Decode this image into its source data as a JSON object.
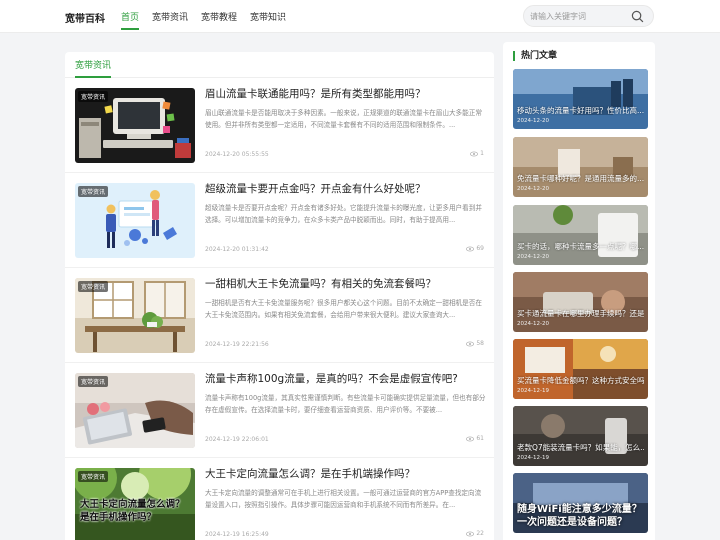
{
  "header": {
    "brand": "宽带百科",
    "nav": [
      "首页",
      "宽带资讯",
      "宽带教程",
      "宽带知识"
    ],
    "search_placeholder": "请输入关键字词"
  },
  "main": {
    "tab": "宽带资讯",
    "articles": [
      {
        "badge": "宽带资讯",
        "title": "眉山流量卡联通能用吗？是所有类型都能用吗？",
        "desc": "眉山联通流量卡是否能用取决于多种因素。一般来说，正规渠道的联通流量卡在眉山大多能正常使用。但并非所有类型都一定适用，不同流量卡套餐有不同的适用范围和限制条件。...",
        "date": "2024-12-20 05:55:55",
        "views": "1"
      },
      {
        "badge": "宽带资讯",
        "title": "超级流量卡要开点金吗？开点金有什么好处呢？",
        "desc": "超级流量卡是否要开点金呢？开点金有诸多好处。它能提升流量卡的曝光度，让更多用户看到并选择。可以增加流量卡的竞争力，在众多卡类产品中脱颖而出。同时，有助于提高用...",
        "date": "2024-12-20 01:31:42",
        "views": "69"
      },
      {
        "badge": "宽带资讯",
        "title": "一甜相机大王卡免流量吗？有相关的免流套餐吗？",
        "desc": "一甜相机是否有大王卡免流量服务呢？很多用户都关心这个问题。目前不太确定一甜相机是否在大王卡免流范围内。如果有相关免流套餐，会给用户带来很大便利。建议大家查询大...",
        "date": "2024-12-19 22:21:56",
        "views": "58"
      },
      {
        "badge": "宽带资讯",
        "title": "流量卡声称100g流量，是真的吗？不会是虚假宣传吧?",
        "desc": "流量卡声称有100g流量，其真实性需谨慎判断。有些流量卡可能确实提供足量流量，但也有部分存在虚假宣传。在选择流量卡时，要仔细查看运营商资质、用户评价等。不要被...",
        "date": "2024-12-19 22:06:01",
        "views": "61"
      },
      {
        "badge": "宽带资讯",
        "title": "大王卡定向流量怎么调？是在手机端操作吗？",
        "desc": "大王卡定向流量的调整通常可在手机上进行相关设置。一般可通过运营商的官方APP查找定向流量设置入口，按照指引操作。具体步骤可能因运营商和手机系统不同而有所差异。在...",
        "date": "2024-12-19 16:25:49",
        "views": "22",
        "thumb_text": "大王卡定向流量怎么调？是在手机操作吗？"
      }
    ]
  },
  "sidebar": {
    "title": "热门文章",
    "items": [
      {
        "title": "移动头条的流量卡好用吗？性价比高...",
        "date": "2024-12-20"
      },
      {
        "title": "免流量卡哪种好呢？是通用流量多的...",
        "date": "2024-12-20"
      },
      {
        "title": "买卡的话，哪种卡流量多一点呢？哪...",
        "date": "2024-12-20"
      },
      {
        "title": "买卡通流量卡在哪里办理手续吗？还是...",
        "date": "2024-12-20"
      },
      {
        "title": "买流量卡降低金额吗？这种方式安全吗？",
        "date": "2024-12-19"
      },
      {
        "title": "老款Q7能装流量卡吗？如果能，怎么...",
        "date": "2024-12-19"
      },
      {
        "title": "",
        "date": "",
        "big_text": "随身WiFi能注意多少流量？一次问题还是设备问题？"
      }
    ]
  },
  "colors": {
    "accent": "#2e9e3e"
  }
}
